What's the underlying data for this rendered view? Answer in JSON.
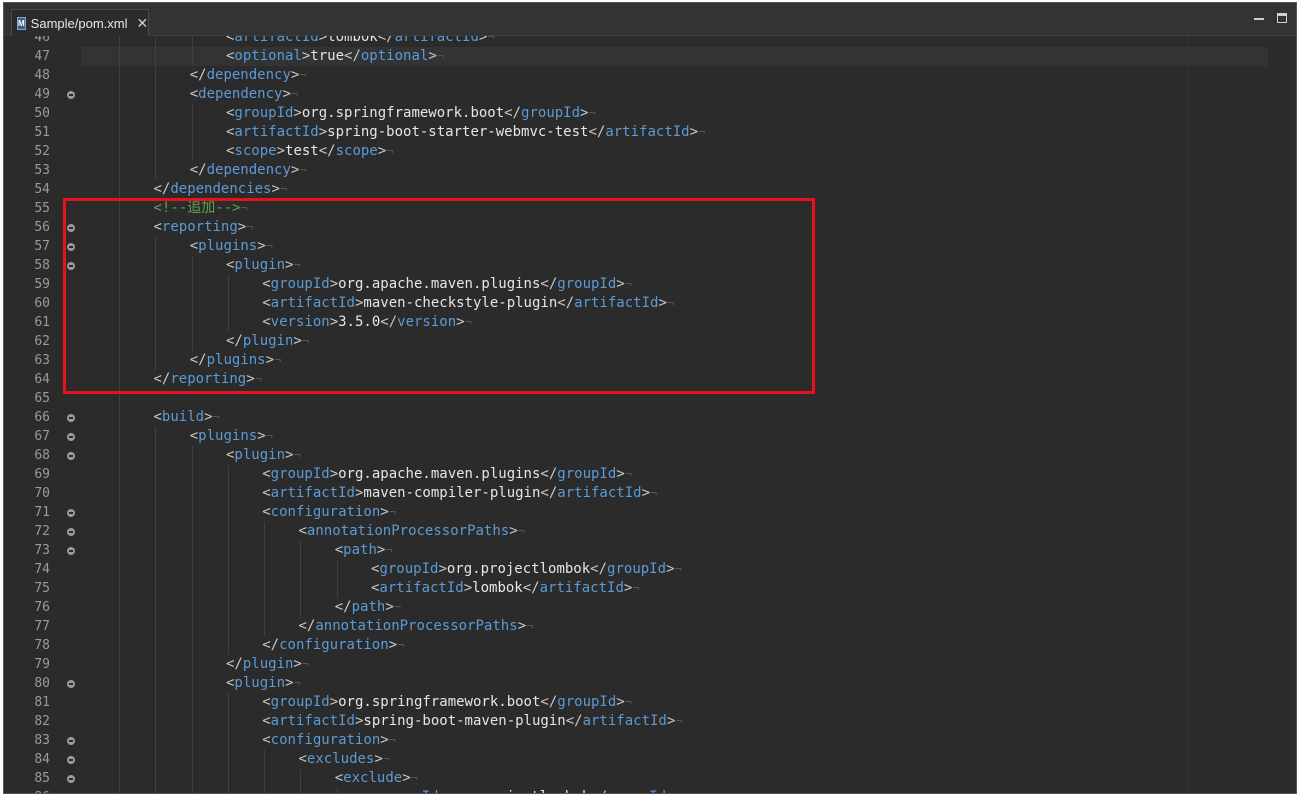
{
  "tab": {
    "title": "Sample/pom.xml",
    "icon": "maven-file-icon",
    "close_icon": "close-icon"
  },
  "window_controls": [
    "minimize-icon",
    "maximize-icon"
  ],
  "editor": {
    "first_line": 46,
    "folded_lines": [
      49,
      56,
      57,
      58,
      66,
      67,
      68,
      71,
      72,
      73,
      80,
      83,
      84,
      85
    ],
    "current_line": 47,
    "lines": [
      {
        "n": "46",
        "indent": 4,
        "t": "<artifactId>lombok</artifactId>"
      },
      {
        "n": "47",
        "indent": 4,
        "t": "<optional>true</optional>"
      },
      {
        "n": "48",
        "indent": 3,
        "t": "</dependency>"
      },
      {
        "n": "49",
        "indent": 3,
        "t": "<dependency>"
      },
      {
        "n": "50",
        "indent": 4,
        "t": "<groupId>org.springframework.boot</groupId>"
      },
      {
        "n": "51",
        "indent": 4,
        "t": "<artifactId>spring-boot-starter-webmvc-test</artifactId>"
      },
      {
        "n": "52",
        "indent": 4,
        "t": "<scope>test</scope>"
      },
      {
        "n": "53",
        "indent": 3,
        "t": "</dependency>"
      },
      {
        "n": "54",
        "indent": 2,
        "t": "</dependencies>"
      },
      {
        "n": "55",
        "indent": 2,
        "t": "<!--追加-->",
        "comment": true
      },
      {
        "n": "56",
        "indent": 2,
        "t": "<reporting>"
      },
      {
        "n": "57",
        "indent": 3,
        "t": "<plugins>"
      },
      {
        "n": "58",
        "indent": 4,
        "t": "<plugin>"
      },
      {
        "n": "59",
        "indent": 5,
        "t": "<groupId>org.apache.maven.plugins</groupId>"
      },
      {
        "n": "60",
        "indent": 5,
        "t": "<artifactId>maven-checkstyle-plugin</artifactId>"
      },
      {
        "n": "61",
        "indent": 5,
        "t": "<version>3.5.0</version>"
      },
      {
        "n": "62",
        "indent": 4,
        "t": "</plugin>"
      },
      {
        "n": "63",
        "indent": 3,
        "t": "</plugins>"
      },
      {
        "n": "64",
        "indent": 2,
        "t": "</reporting>"
      },
      {
        "n": "65",
        "indent": 2,
        "t": ""
      },
      {
        "n": "66",
        "indent": 2,
        "t": "<build>"
      },
      {
        "n": "67",
        "indent": 3,
        "t": "<plugins>"
      },
      {
        "n": "68",
        "indent": 4,
        "t": "<plugin>"
      },
      {
        "n": "69",
        "indent": 5,
        "t": "<groupId>org.apache.maven.plugins</groupId>"
      },
      {
        "n": "70",
        "indent": 5,
        "t": "<artifactId>maven-compiler-plugin</artifactId>"
      },
      {
        "n": "71",
        "indent": 5,
        "t": "<configuration>"
      },
      {
        "n": "72",
        "indent": 6,
        "t": "<annotationProcessorPaths>"
      },
      {
        "n": "73",
        "indent": 7,
        "t": "<path>"
      },
      {
        "n": "74",
        "indent": 8,
        "t": "<groupId>org.projectlombok</groupId>"
      },
      {
        "n": "75",
        "indent": 8,
        "t": "<artifactId>lombok</artifactId>"
      },
      {
        "n": "76",
        "indent": 7,
        "t": "</path>"
      },
      {
        "n": "77",
        "indent": 6,
        "t": "</annotationProcessorPaths>"
      },
      {
        "n": "78",
        "indent": 5,
        "t": "</configuration>"
      },
      {
        "n": "79",
        "indent": 4,
        "t": "</plugin>"
      },
      {
        "n": "80",
        "indent": 4,
        "t": "<plugin>"
      },
      {
        "n": "81",
        "indent": 5,
        "t": "<groupId>org.springframework.boot</groupId>"
      },
      {
        "n": "82",
        "indent": 5,
        "t": "<artifactId>spring-boot-maven-plugin</artifactId>"
      },
      {
        "n": "83",
        "indent": 5,
        "t": "<configuration>"
      },
      {
        "n": "84",
        "indent": 6,
        "t": "<excludes>"
      },
      {
        "n": "85",
        "indent": 7,
        "t": "<exclude>"
      },
      {
        "n": "86",
        "indent": 8,
        "t": "<groupId>org.projectlombok</groupId>"
      }
    ]
  },
  "annotation": {
    "color": "#e8121a",
    "from_line": "55",
    "to_line": "64"
  },
  "colors": {
    "background": "#2b2b2b",
    "tag": "#5b9bd6",
    "text": "#e6e6e6",
    "comment": "#57a64a",
    "line_number": "#9a9a9a"
  }
}
